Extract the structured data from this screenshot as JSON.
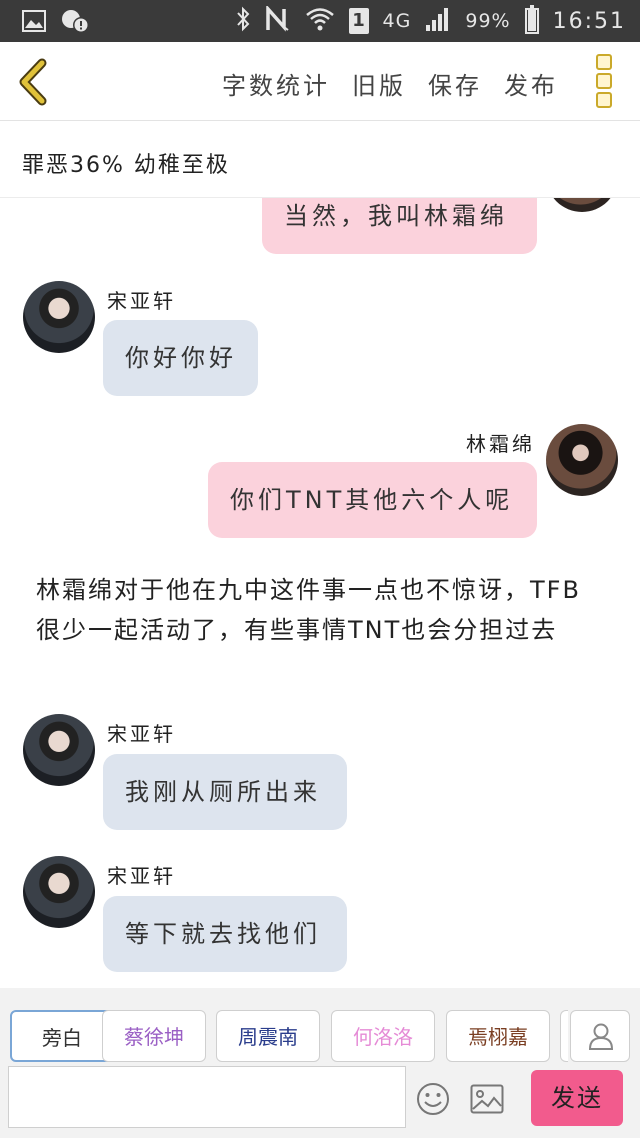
{
  "status_bar": {
    "network_type": "4G",
    "sim_slot": "1",
    "battery": "99%",
    "battery_level": 0.99,
    "time": "16:51"
  },
  "toolbar": {
    "actions": [
      "字数统计",
      "旧版",
      "保存",
      "发布"
    ]
  },
  "subtitle": "罪恶36% 幼稚至极",
  "messages": [
    {
      "type": "right",
      "text": "当然，我叫林霜绵"
    },
    {
      "type": "left",
      "sender": "宋亚轩",
      "text": "你好你好"
    },
    {
      "type": "right",
      "sender": "林霜绵",
      "text": "你们TNT其他六个人呢"
    },
    {
      "type": "narration",
      "text": "林霜绵对于他在九中这件事一点也不惊讶，TFB很少一起活动了，有些事情TNT也会分担过去"
    },
    {
      "type": "left",
      "sender": "宋亚轩",
      "text": "我刚从厕所出来"
    },
    {
      "type": "left",
      "sender": "宋亚轩",
      "text": "等下就去找他们"
    }
  ],
  "roles": [
    {
      "label": "旁白",
      "color": "#333333"
    },
    {
      "label": "蔡徐坤",
      "color": "#9a5fc4"
    },
    {
      "label": "周震南",
      "color": "#2a3d8c"
    },
    {
      "label": "何洛洛",
      "color": "#e58bd6"
    },
    {
      "label": "焉栩嘉",
      "color": "#7a3e22"
    }
  ],
  "composer": {
    "input_value": "",
    "send_label": "发送"
  },
  "colors": {
    "accent": "#f25b8d",
    "bubble_pink": "#fbd2dc",
    "bubble_blue": "#dde4ee",
    "back_icon": "#e0c23a"
  }
}
